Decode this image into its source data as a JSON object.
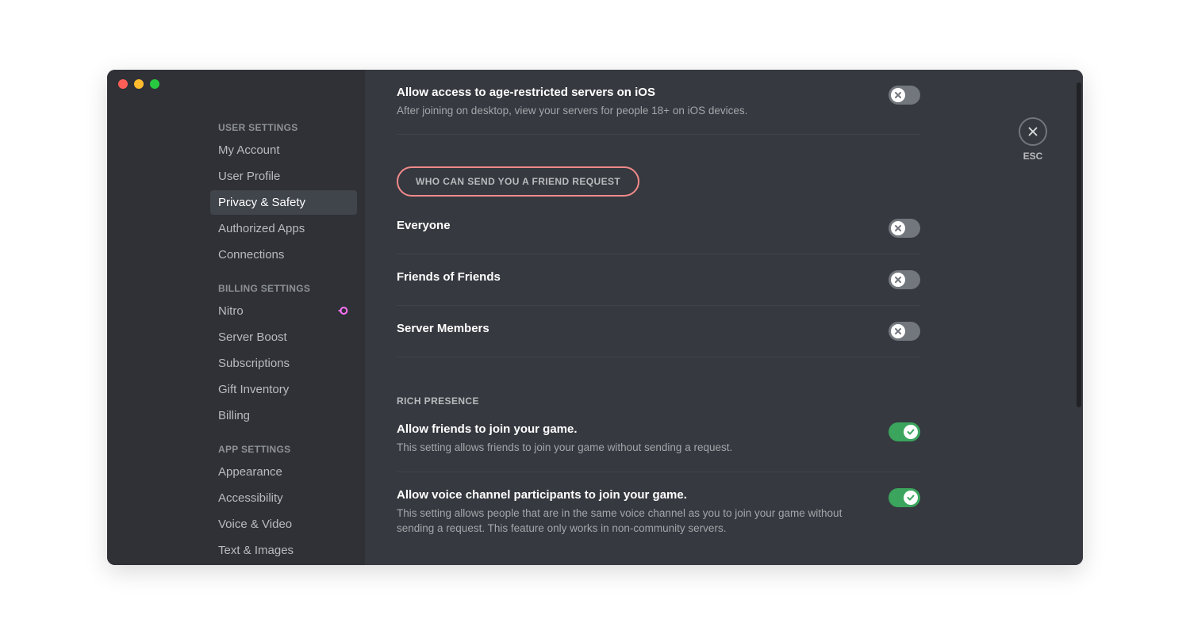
{
  "window": {
    "close_label": "ESC"
  },
  "sidebar": {
    "groups": [
      {
        "header": "USER SETTINGS",
        "items": [
          {
            "label": "My Account",
            "selected": false
          },
          {
            "label": "User Profile",
            "selected": false
          },
          {
            "label": "Privacy & Safety",
            "selected": true
          },
          {
            "label": "Authorized Apps",
            "selected": false
          },
          {
            "label": "Connections",
            "selected": false
          }
        ]
      },
      {
        "header": "BILLING SETTINGS",
        "items": [
          {
            "label": "Nitro",
            "selected": false,
            "badge": "nitro"
          },
          {
            "label": "Server Boost",
            "selected": false
          },
          {
            "label": "Subscriptions",
            "selected": false
          },
          {
            "label": "Gift Inventory",
            "selected": false
          },
          {
            "label": "Billing",
            "selected": false
          }
        ]
      },
      {
        "header": "APP SETTINGS",
        "items": [
          {
            "label": "Appearance",
            "selected": false
          },
          {
            "label": "Accessibility",
            "selected": false
          },
          {
            "label": "Voice & Video",
            "selected": false
          },
          {
            "label": "Text & Images",
            "selected": false
          }
        ]
      }
    ]
  },
  "content": {
    "age_restricted": {
      "title": "Allow access to age-restricted servers on iOS",
      "desc": "After joining on desktop, view your servers for people 18+ on iOS devices.",
      "on": false
    },
    "friend_request_header": "WHO CAN SEND YOU A FRIEND REQUEST",
    "friend_request": [
      {
        "label": "Everyone",
        "on": false
      },
      {
        "label": "Friends of Friends",
        "on": false
      },
      {
        "label": "Server Members",
        "on": false
      }
    ],
    "rich_presence_header": "RICH PRESENCE",
    "rich_presence": [
      {
        "title": "Allow friends to join your game.",
        "desc": "This setting allows friends to join your game without sending a request.",
        "on": true
      },
      {
        "title": "Allow voice channel participants to join your game.",
        "desc": "This setting allows people that are in the same voice channel as you to join your game without sending a request. This feature only works in non-community servers.",
        "on": true
      }
    ]
  }
}
